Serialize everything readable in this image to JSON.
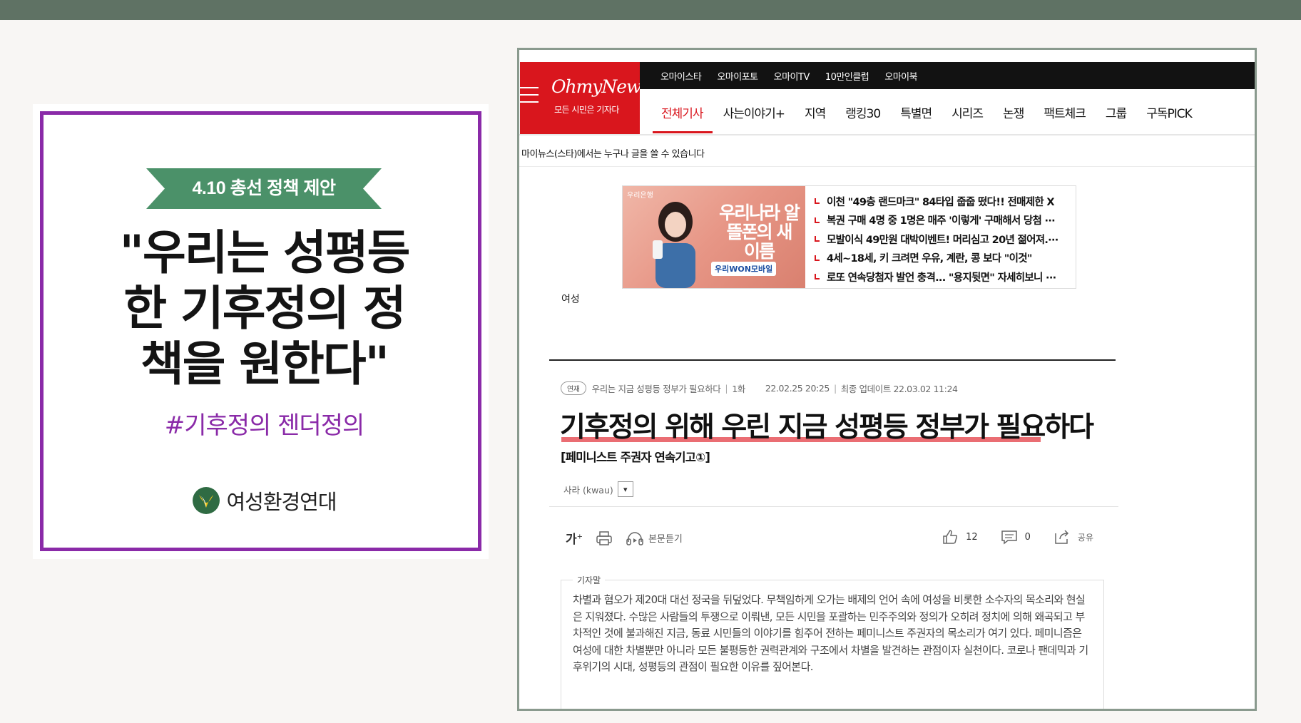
{
  "poster": {
    "ribbon": "4.10 총선 정책 제안",
    "headline": "\"우리는 성평등한 기후정의 정책을 원한다\"",
    "hashtag": "#기후정의 젠더정의",
    "org": "여성환경연대",
    "colors": {
      "frame": "#8a2aa8",
      "ribbon": "#4b9169",
      "hashtag": "#8a2aa8"
    }
  },
  "site": {
    "logo": "OhmyNews",
    "logo_sub": "모든 시민은 기자다",
    "subnav": [
      "오마이스타",
      "오마이포토",
      "오마이TV",
      "10만인클럽",
      "오마이북"
    ],
    "mainnav": [
      "전체기사",
      "사는이야기+",
      "지역",
      "랭킹30",
      "특별면",
      "시리즈",
      "논쟁",
      "팩트체크",
      "그룹",
      "구독PICK"
    ],
    "active_nav": "전체기사",
    "notice": "마이뉴스(스타)에서는 누구나 글을 쓸 수 있습니다",
    "brand_color": "#d9161d"
  },
  "ad": {
    "bank": "우리은행",
    "title": "우리나라 알뜰폰의 새 이름",
    "badge": "우리WON모바일",
    "headlines": [
      "이천 \"49층 랜드마크\" 84타입 줍줍 떴다!! 전매제한 X",
      "복권 구매 4명 중 1명은 매주 '이렇게' 구매해서 당첨 ···",
      "모발이식 49만원 대박이벤트! 머리심고 20년 젊어져.···",
      "4세~18세, 키 크려면 우유, 계란, 콩 보다 \"이것\"",
      "로또 연속당첨자 발언 충격... \"용지뒷면\" 자세히보니 ···"
    ]
  },
  "article": {
    "section": "여성",
    "series_badge": "연재",
    "series_name": "우리는 지금 성평등 정부가 필요하다",
    "episode": "1화",
    "date": "22.02.25 20:25",
    "updated": "최종 업데이트 22.03.02 11:24",
    "title": "기후정의 위해 우린 지금 성평등 정부가 필요하다",
    "subtitle": "[페미니스트 주권자 연속기고①]",
    "author": "사라 (kwau)",
    "toolbar": {
      "font": "가",
      "listen": "본문듣기",
      "likes": "12",
      "comments": "0",
      "share": "공유"
    },
    "note_label": "기자말",
    "note_body": "차별과 혐오가 제20대 대선 정국을 뒤덮었다. 무책임하게 오가는 배제의 언어 속에 여성을 비롯한 소수자의 목소리와 현실은 지워졌다. 수많은 사람들의 투쟁으로 이뤄낸, 모든 시민을 포괄하는 민주주의와 정의가 오히려 정치에 의해 왜곡되고 부차적인 것에 불과해진 지금, 동료 시민들의 이야기를 힘주어 전하는 페미니스트 주권자의 목소리가 여기 있다. 페미니즘은 여성에 대한 차별뿐만 아니라 모든 불평등한 권력관계와 구조에서 차별을 발견하는 관점이자 실천이다. 코로나 팬데믹과 기후위기의 시대, 성평등의 관점이 필요한 이유를 짚어본다.",
    "highlight_color": "#ea6d73"
  }
}
